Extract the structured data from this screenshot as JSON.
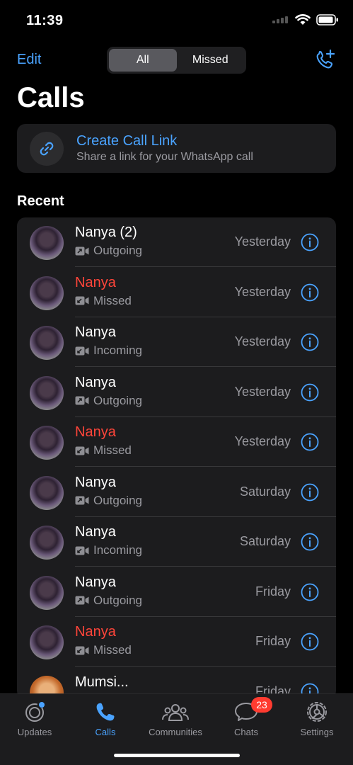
{
  "status": {
    "time": "11:39"
  },
  "header": {
    "edit_label": "Edit",
    "segments": [
      "All",
      "Missed"
    ],
    "title": "Calls"
  },
  "call_link": {
    "title": "Create Call Link",
    "subtitle": "Share a link for your WhatsApp call"
  },
  "recent": {
    "title": "Recent",
    "items": [
      {
        "name": "Nanya (2)",
        "type": "Outgoing",
        "when": "Yesterday",
        "missed": false
      },
      {
        "name": "Nanya",
        "type": "Missed",
        "when": "Yesterday",
        "missed": true
      },
      {
        "name": "Nanya",
        "type": "Incoming",
        "when": "Yesterday",
        "missed": false
      },
      {
        "name": "Nanya",
        "type": "Outgoing",
        "when": "Yesterday",
        "missed": false
      },
      {
        "name": "Nanya",
        "type": "Missed",
        "when": "Yesterday",
        "missed": true
      },
      {
        "name": "Nanya",
        "type": "Outgoing",
        "when": "Saturday",
        "missed": false
      },
      {
        "name": "Nanya",
        "type": "Incoming",
        "when": "Saturday",
        "missed": false
      },
      {
        "name": "Nanya",
        "type": "Outgoing",
        "when": "Friday",
        "missed": false
      },
      {
        "name": "Nanya",
        "type": "Missed",
        "when": "Friday",
        "missed": true
      },
      {
        "name": "Mumsi...",
        "type": "",
        "when": "Friday",
        "missed": false
      }
    ]
  },
  "tabs": {
    "updates": "Updates",
    "calls": "Calls",
    "communities": "Communities",
    "chats": "Chats",
    "settings": "Settings",
    "chats_badge": "23"
  },
  "colors": {
    "accent": "#4aa3ff",
    "missed": "#ff453a",
    "badge": "#ff3b30"
  }
}
